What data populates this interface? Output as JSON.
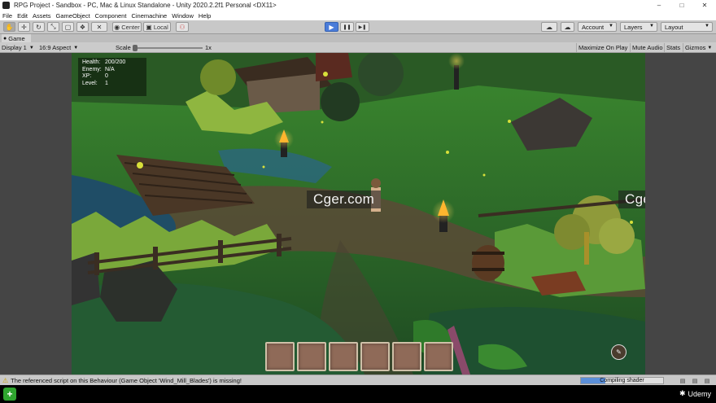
{
  "window": {
    "title": "RPG Project - Sandbox - PC, Mac & Linux Standalone - Unity 2020.2.2f1 Personal <DX11>",
    "controls": {
      "minimize": "–",
      "maximize": "□",
      "close": "✕"
    }
  },
  "menu": [
    "File",
    "Edit",
    "Assets",
    "GameObject",
    "Component",
    "Cinemachine",
    "Window",
    "Help"
  ],
  "toolbar": {
    "tools": [
      {
        "icon": "hand-icon",
        "glyph": "✋"
      },
      {
        "icon": "move-icon",
        "glyph": "✛"
      },
      {
        "icon": "rotate-icon",
        "glyph": "↻"
      },
      {
        "icon": "scale-icon",
        "glyph": "⤡"
      },
      {
        "icon": "rect-icon",
        "glyph": "▢"
      },
      {
        "icon": "transform-icon",
        "glyph": "❖"
      },
      {
        "icon": "custom-tool-icon",
        "glyph": "✕"
      }
    ],
    "pivot": "Center",
    "space": "Local",
    "snap_icon": "grid-snap-icon",
    "play": {
      "glyph": "▶"
    },
    "pause": {
      "glyph": "❚❚"
    },
    "step": {
      "glyph": "▶❚"
    },
    "cloud_icon": "cloud-icon",
    "account": "Account",
    "layers": "Layers",
    "layout": "Layout"
  },
  "game_tab": {
    "label": "Game",
    "icon": "gamepad-icon"
  },
  "game_controls": {
    "display": "Display 1",
    "aspect": "16:9 Aspect",
    "scale_label": "Scale",
    "scale_value": "1x",
    "maximize": "Maximize On Play",
    "mute": "Mute Audio",
    "stats": "Stats",
    "gizmos": "Gizmos"
  },
  "hud": {
    "stats": [
      {
        "label": "Health:",
        "value": "200/200"
      },
      {
        "label": "Enemy:",
        "value": "N/A"
      },
      {
        "label": "XP:",
        "value": "0"
      },
      {
        "label": "Level:",
        "value": "1"
      }
    ],
    "slot_count": 6
  },
  "watermarks": [
    "Cger.com",
    "Cger.com"
  ],
  "status": {
    "message": "The referenced script on this Behaviour (Game Object 'Wind_Mill_Blades') is missing!",
    "progress_text": "Compiling shader",
    "progress": 0.3
  },
  "taskbar": {
    "brand": "Udemy"
  },
  "colors": {
    "play_accent": "#4a7cd9",
    "hud_slot": "#8f6a58",
    "warning": "#c9a000"
  }
}
